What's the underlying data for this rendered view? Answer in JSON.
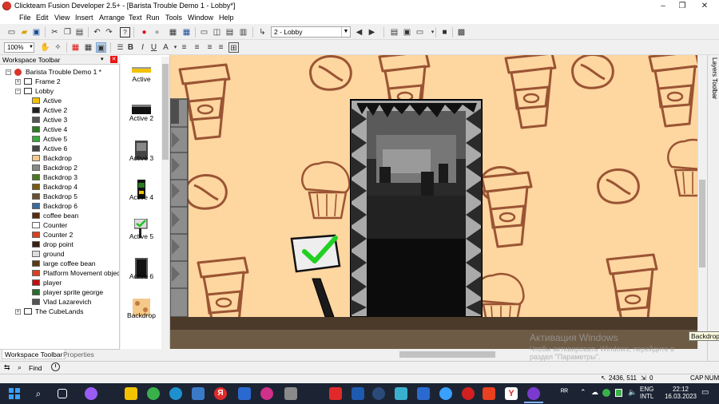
{
  "window": {
    "title": "Clickteam Fusion Developer 2.5+ - [Barista Trouble Demo 1 - Lobby*]",
    "minimize": "–",
    "restore": "❐",
    "close": "✕"
  },
  "menu": [
    "File",
    "Edit",
    "View",
    "Insert",
    "Arrange",
    "Text",
    "Run",
    "Tools",
    "Window",
    "Help"
  ],
  "toolbar": {
    "frame_select": "2 - Lobby",
    "zoom": "100%"
  },
  "workspace": {
    "title": "Workspace Toolbar",
    "pin": "▾",
    "close": "✕",
    "tree": [
      {
        "label": "Barista Trouble Demo 1 *",
        "level": 0,
        "kind": "app",
        "expander": "−"
      },
      {
        "label": "Frame 2",
        "level": 1,
        "kind": "frame",
        "expander": "+"
      },
      {
        "label": "Lobby",
        "level": 1,
        "kind": "frame",
        "expander": "−"
      },
      {
        "label": "Active",
        "level": 2,
        "kind": "obj",
        "color": "#f2c200"
      },
      {
        "label": "Active 2",
        "level": 2,
        "kind": "obj",
        "color": "#202020"
      },
      {
        "label": "Active 3",
        "level": 2,
        "kind": "obj",
        "color": "#555555"
      },
      {
        "label": "Active 4",
        "level": 2,
        "kind": "obj",
        "color": "#2a7a20"
      },
      {
        "label": "Active 5",
        "level": 2,
        "kind": "obj",
        "color": "#3aa83a"
      },
      {
        "label": "Active 6",
        "level": 2,
        "kind": "obj",
        "color": "#444444"
      },
      {
        "label": "Backdrop",
        "level": 2,
        "kind": "obj",
        "color": "#f4c98a"
      },
      {
        "label": "Backdrop 2",
        "level": 2,
        "kind": "obj",
        "color": "#888888"
      },
      {
        "label": "Backdrop 3",
        "level": 2,
        "kind": "obj",
        "color": "#4a7a20"
      },
      {
        "label": "Backdrop 4",
        "level": 2,
        "kind": "obj",
        "color": "#7a5a10"
      },
      {
        "label": "Backdrop 5",
        "level": 2,
        "kind": "obj",
        "color": "#6a5030"
      },
      {
        "label": "Backdrop 6",
        "level": 2,
        "kind": "obj",
        "color": "#3a6aa0"
      },
      {
        "label": "coffee bean",
        "level": 2,
        "kind": "obj",
        "color": "#5a2a10"
      },
      {
        "label": "Counter",
        "level": 2,
        "kind": "obj",
        "color": "#ffffff"
      },
      {
        "label": "Counter 2",
        "level": 2,
        "kind": "obj",
        "color": "#d94020"
      },
      {
        "label": "drop point",
        "level": 2,
        "kind": "obj",
        "color": "#3a2010"
      },
      {
        "label": "ground",
        "level": 2,
        "kind": "obj",
        "color": "#dddddd"
      },
      {
        "label": "large coffee bean",
        "level": 2,
        "kind": "obj",
        "color": "#5a3a10"
      },
      {
        "label": "Platform Movement objec",
        "level": 2,
        "kind": "obj",
        "color": "#d94020"
      },
      {
        "label": "player",
        "level": 2,
        "kind": "obj",
        "color": "#c01010"
      },
      {
        "label": "player sprite george",
        "level": 2,
        "kind": "obj",
        "color": "#2a6a2a"
      },
      {
        "label": "Vlad Lazarevich",
        "level": 2,
        "kind": "obj",
        "color": "#555555"
      },
      {
        "label": "The CubeLands",
        "level": 1,
        "kind": "frame",
        "expander": "+"
      }
    ],
    "tabs": [
      "Workspace Toolbar",
      "Properties"
    ]
  },
  "shelf": [
    {
      "label": "Active",
      "icon": "yellow-bar"
    },
    {
      "label": "Active 2",
      "icon": "dark-bar"
    },
    {
      "label": "Active 3",
      "icon": "dark-tile"
    },
    {
      "label": "Active 4",
      "icon": "character"
    },
    {
      "label": "Active 5",
      "icon": "sign"
    },
    {
      "label": "Active 6",
      "icon": "dark-door"
    },
    {
      "label": "Backdrop",
      "icon": "orange-tile"
    }
  ],
  "find": {
    "label": "Find"
  },
  "layers_label": "Layers Toolbar",
  "tooltip": "Backdrop",
  "watermark": {
    "line1": "Активация Windows",
    "line2": "Чтобы активировать Windows, перейдите в раздел \"Параметры\"."
  },
  "status": {
    "coords": "2436, 511",
    "count": "0",
    "caps": "CAP",
    "num": "NUM"
  },
  "taskbar": {
    "lang_top": "ENG",
    "lang_bottom": "INTL",
    "time": "22:12",
    "date": "16.03.2023"
  },
  "colors": {
    "canvas_bg": "#fdd6a0",
    "stroke": "#9a5433",
    "ground": "#6d5b45",
    "ground_top": "#4b3a2a"
  }
}
